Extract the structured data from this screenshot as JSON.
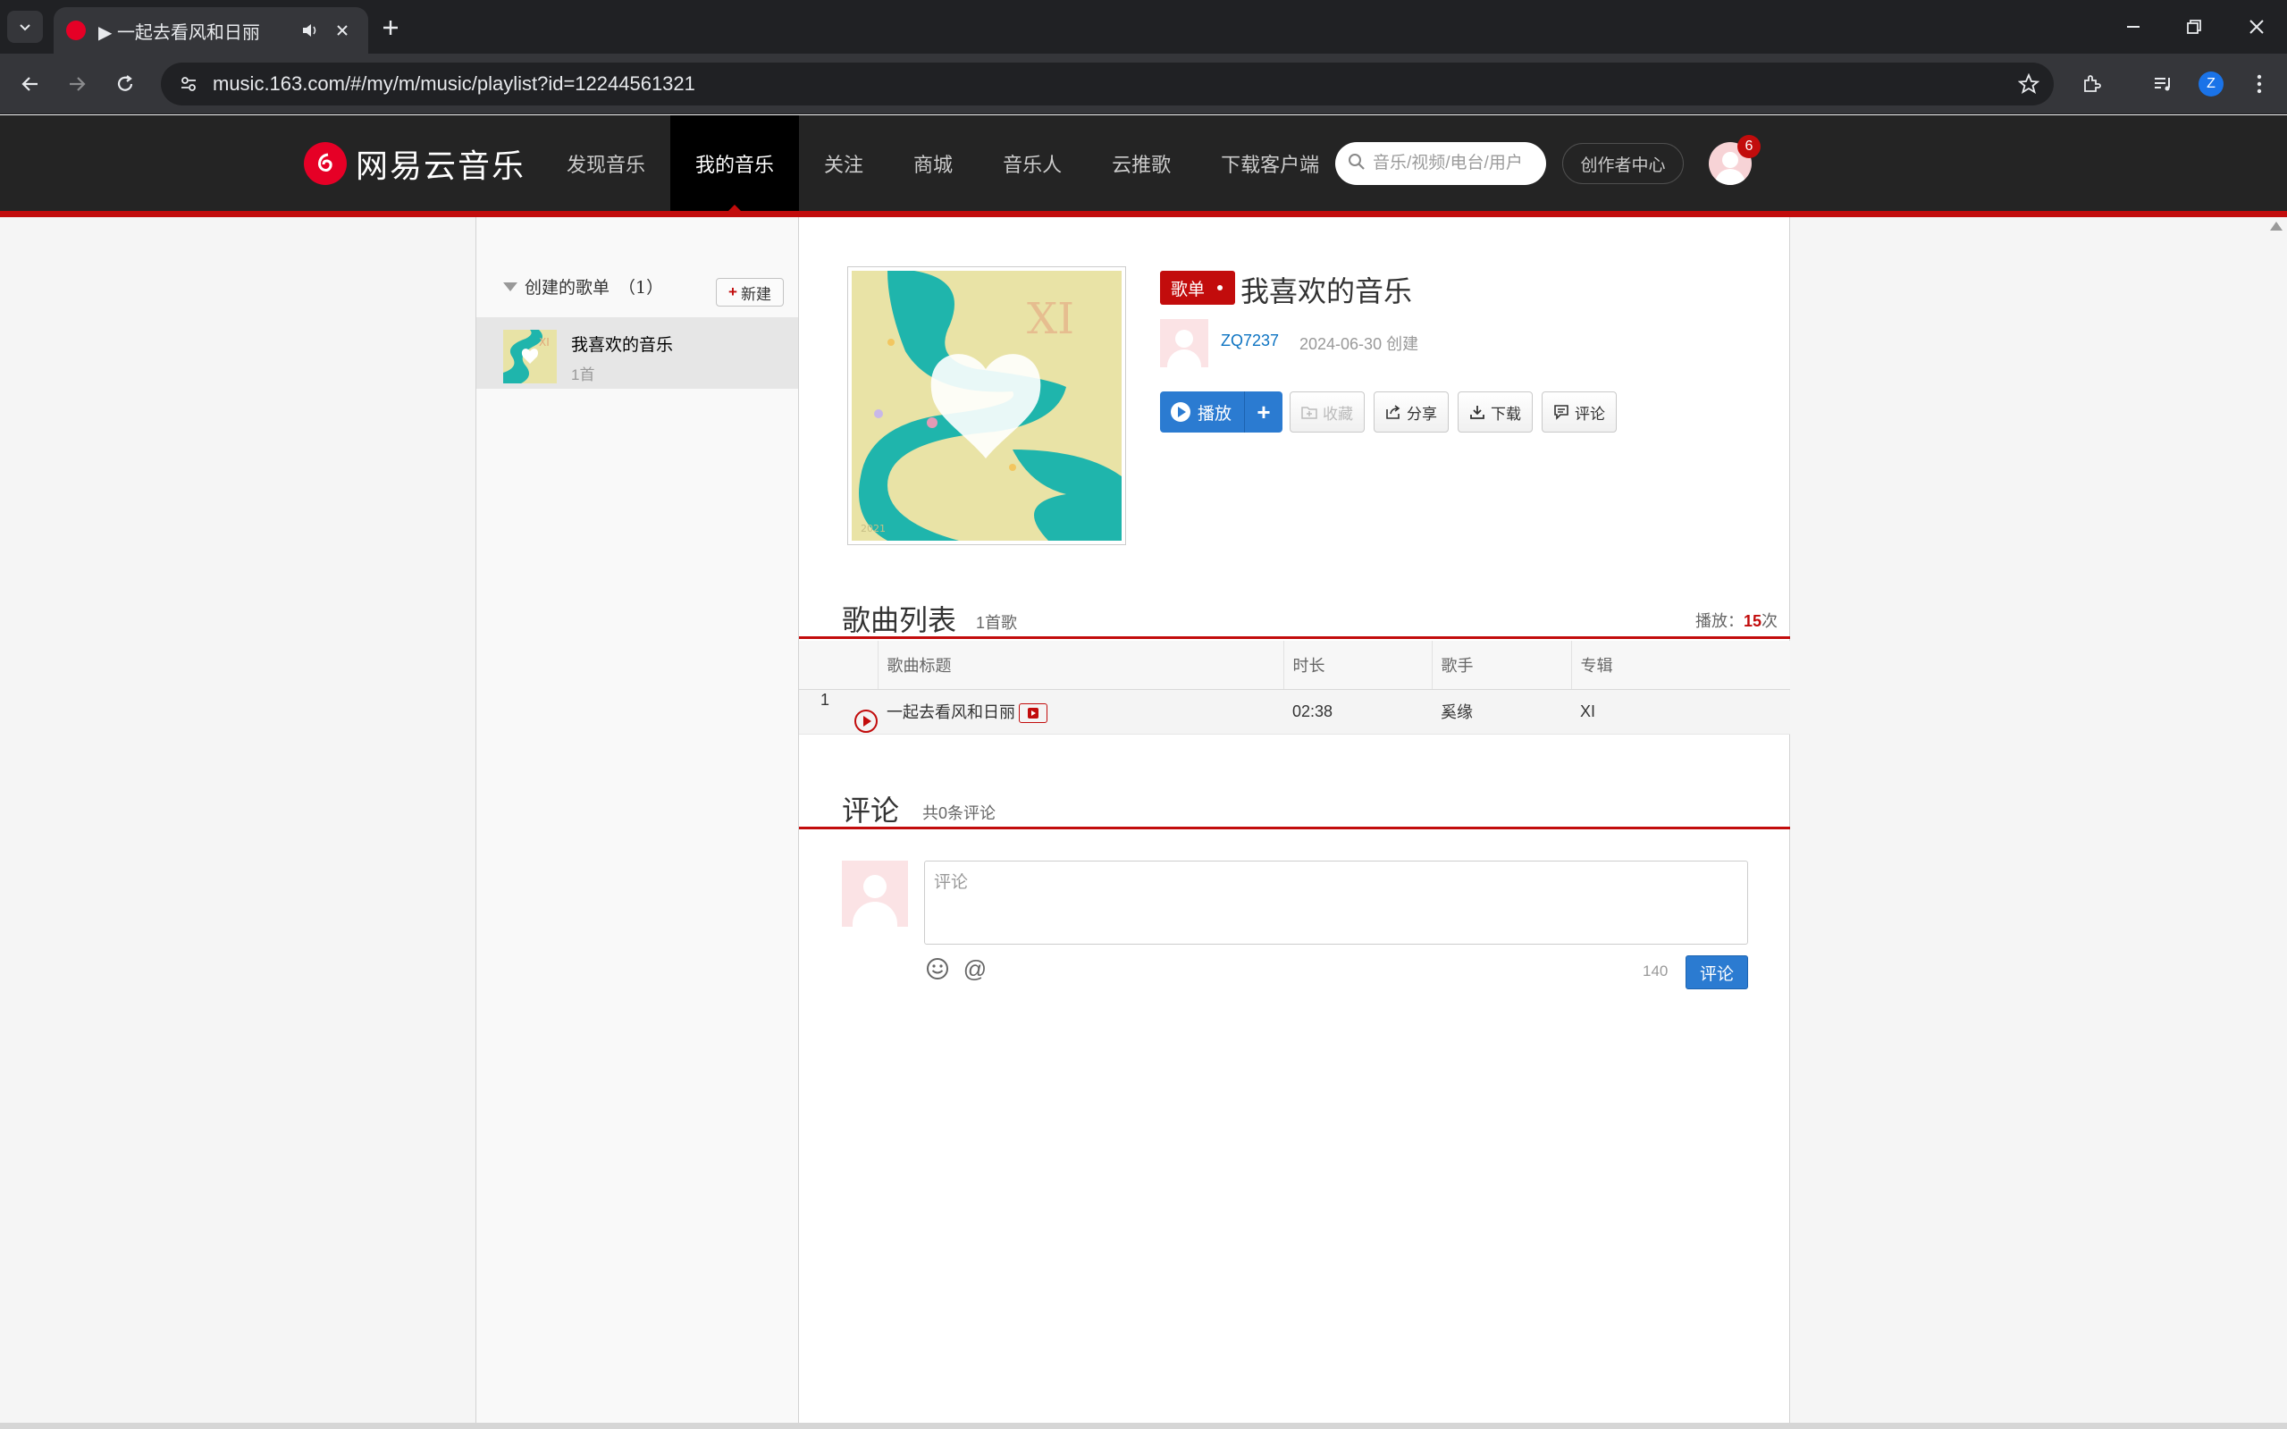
{
  "browser": {
    "tab_title": "▶ 一起去看风和日丽",
    "url": "music.163.com/#/my/m/music/playlist?id=12244561321",
    "profile_initial": "Z"
  },
  "header": {
    "logo_text": "网易云音乐",
    "nav": [
      {
        "label": "发现音乐",
        "active": false
      },
      {
        "label": "我的音乐",
        "active": true
      },
      {
        "label": "关注",
        "active": false
      },
      {
        "label": "商城",
        "active": false
      },
      {
        "label": "音乐人",
        "active": false
      },
      {
        "label": "云推歌",
        "active": false
      },
      {
        "label": "下载客户端",
        "active": false
      }
    ],
    "search_placeholder": "音乐/视频/电台/用户",
    "creator_center": "创作者中心",
    "notification_count": "6"
  },
  "sidebar": {
    "section_title": "创建的歌单",
    "section_count": "（1）",
    "new_button": "新建",
    "playlists": [
      {
        "name": "我喜欢的音乐",
        "count": "1首"
      }
    ]
  },
  "playlist": {
    "tag": "歌单",
    "title": "我喜欢的音乐",
    "creator": "ZQ7237",
    "created": "2024-06-30 创建",
    "actions": {
      "play": "播放",
      "add": "+",
      "collect": "收藏",
      "share": "分享",
      "download": "下载",
      "comment": "评论"
    }
  },
  "song_list": {
    "title": "歌曲列表",
    "count": "1首歌",
    "play_label": "播放：",
    "play_count": "15",
    "play_unit": "次",
    "columns": [
      "",
      "歌曲标题",
      "时长",
      "歌手",
      "专辑"
    ],
    "songs": [
      {
        "index": "1",
        "title": "一起去看风和日丽",
        "duration": "02:38",
        "artist": "奚缘",
        "album": "XI"
      }
    ]
  },
  "comments": {
    "title": "评论",
    "count": "共0条评论",
    "placeholder": "评论",
    "char_limit": "140",
    "submit": "评论"
  },
  "colors": {
    "accent_red": "#c20c0c",
    "header_bg": "#242424",
    "button_blue": "#2b7bd1",
    "link_blue": "#0c73c2"
  }
}
